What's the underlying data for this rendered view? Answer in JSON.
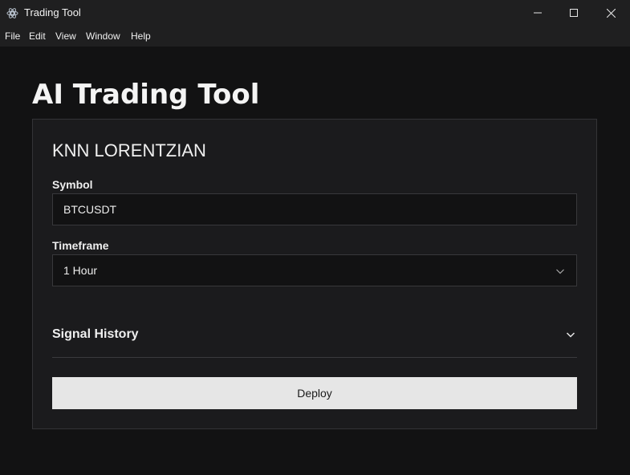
{
  "window": {
    "title": "Trading Tool"
  },
  "menu": {
    "items": [
      "File",
      "Edit",
      "View",
      "Window",
      "Help"
    ]
  },
  "page": {
    "title": "AI Trading Tool"
  },
  "card": {
    "title": "KNN LORENTZIAN",
    "symbol": {
      "label": "Symbol",
      "value": "BTCUSDT"
    },
    "timeframe": {
      "label": "Timeframe",
      "selected": "1 Hour"
    },
    "signal_history": {
      "label": "Signal History",
      "icon": "chevron-down-icon"
    },
    "deploy_label": "Deploy"
  },
  "colors": {
    "background": "#121213",
    "card": "#1b1b1d",
    "button": "#e6e6e6",
    "titlebar": "#1f1f20"
  }
}
